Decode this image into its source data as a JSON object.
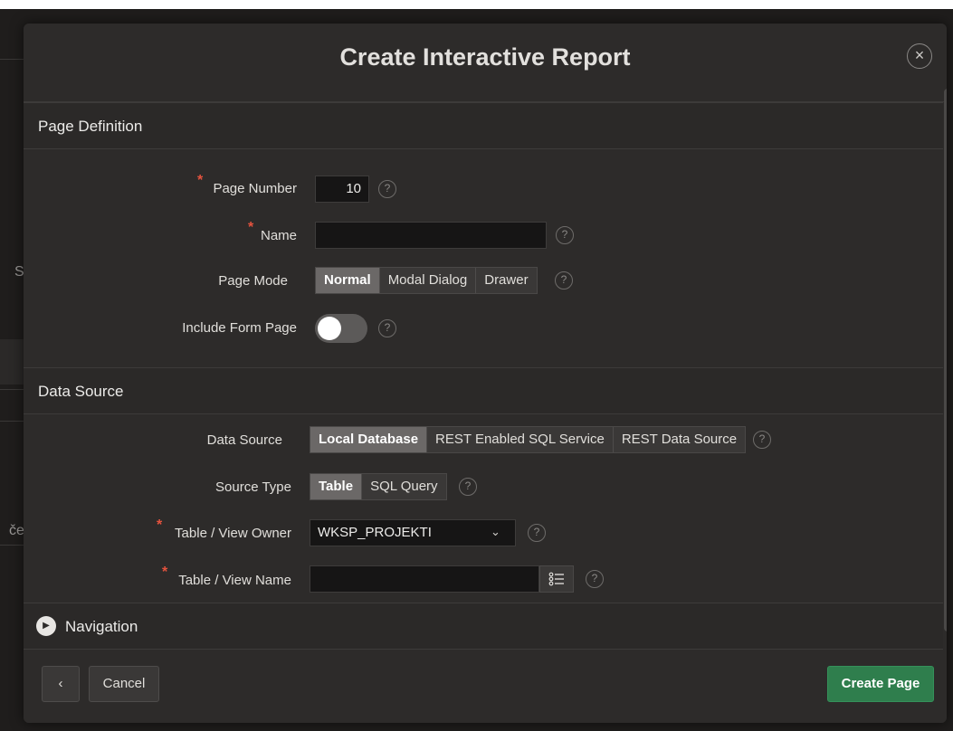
{
  "background": {
    "left_letter_1": "S",
    "left_letter_2": "če"
  },
  "dialog": {
    "title": "Create Interactive Report",
    "close_icon": "×"
  },
  "page_definition": {
    "section_title": "Page Definition",
    "page_number": {
      "label": "Page Number",
      "value": "10",
      "required_marker": "*"
    },
    "name": {
      "label": "Name",
      "value": "",
      "required_marker": "*"
    },
    "page_mode": {
      "label": "Page Mode",
      "options": [
        "Normal",
        "Modal Dialog",
        "Drawer"
      ],
      "selected": "Normal"
    },
    "include_form_page": {
      "label": "Include Form Page",
      "on": false
    }
  },
  "data_source": {
    "section_title": "Data Source",
    "data_source": {
      "label": "Data Source",
      "options": [
        "Local Database",
        "REST Enabled SQL Service",
        "REST Data Source"
      ],
      "selected": "Local Database"
    },
    "source_type": {
      "label": "Source Type",
      "options": [
        "Table",
        "SQL Query"
      ],
      "selected": "Table"
    },
    "table_view_owner": {
      "label": "Table / View Owner",
      "value": "WKSP_PROJEKTI",
      "required_marker": "*"
    },
    "table_view_name": {
      "label": "Table / View Name",
      "value": "",
      "required_marker": "*"
    }
  },
  "navigation": {
    "label": "Navigation"
  },
  "footer": {
    "back_icon": "‹",
    "cancel_label": "Cancel",
    "create_label": "Create Page"
  },
  "help_icon": "?",
  "colors": {
    "accent_green": "#2f7e4d",
    "required_red": "#e5533e",
    "dialog_bg": "#2d2b2a"
  }
}
